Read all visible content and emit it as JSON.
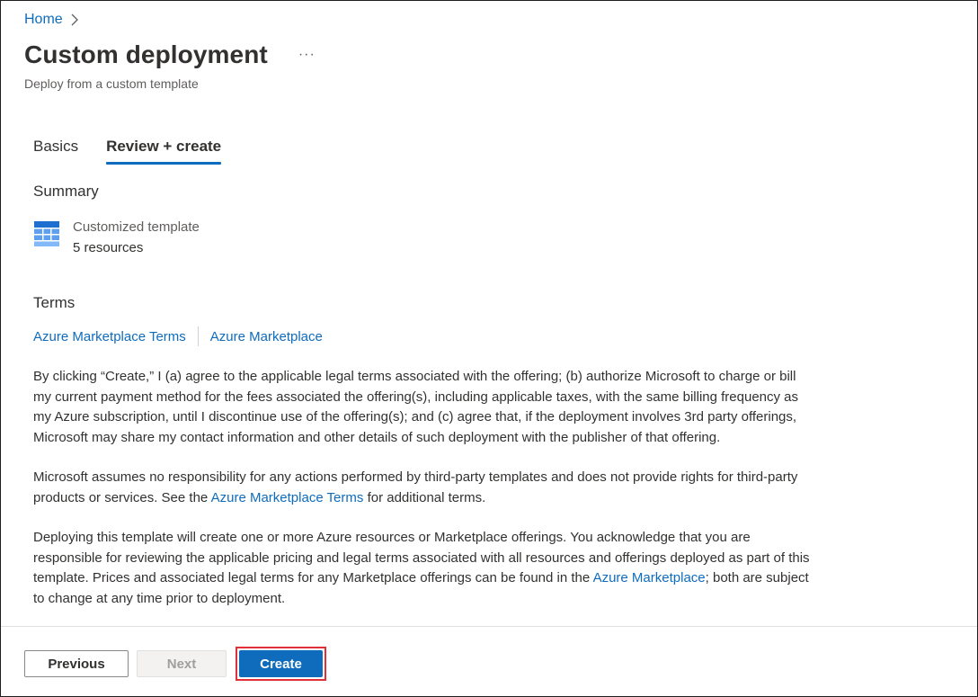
{
  "breadcrumb": {
    "home": "Home"
  },
  "header": {
    "title": "Custom deployment",
    "more": "···",
    "subtitle": "Deploy from a custom template"
  },
  "tabs": [
    {
      "label": "Basics",
      "active": false
    },
    {
      "label": "Review + create",
      "active": true
    }
  ],
  "summary": {
    "heading": "Summary",
    "item_name": "Customized template",
    "item_count": "5 resources",
    "icon": "template-grid-icon"
  },
  "terms": {
    "heading": "Terms",
    "link1": "Azure Marketplace Terms",
    "link2": "Azure Marketplace",
    "para1": "By clicking “Create,” I (a) agree to the applicable legal terms associated with the offering; (b) authorize Microsoft to charge or bill my current payment method for the fees associated the offering(s), including applicable taxes, with the same billing frequency as my Azure subscription, until I discontinue use of the offering(s); and (c) agree that, if the deployment involves 3rd party offerings, Microsoft may share my contact information and other details of such deployment with the publisher of that offering.",
    "para2_pre": "Microsoft assumes no responsibility for any actions performed by third-party templates and does not provide rights for third-party products or services. See the ",
    "para2_link": "Azure Marketplace Terms",
    "para2_post": " for additional terms.",
    "para3_pre": "Deploying this template will create one or more Azure resources or Marketplace offerings.  You acknowledge that you are responsible for reviewing the applicable pricing and legal terms associated with all resources and offerings deployed as part of this template.  Prices and associated legal terms for any Marketplace offerings can be found in the ",
    "para3_link": "Azure Marketplace",
    "para3_post": "; both are subject to change at any time prior to deployment."
  },
  "footer": {
    "previous": "Previous",
    "next": "Next",
    "create": "Create"
  },
  "colors": {
    "accent": "#0f6cbd",
    "highlight_border": "#e0313b"
  }
}
